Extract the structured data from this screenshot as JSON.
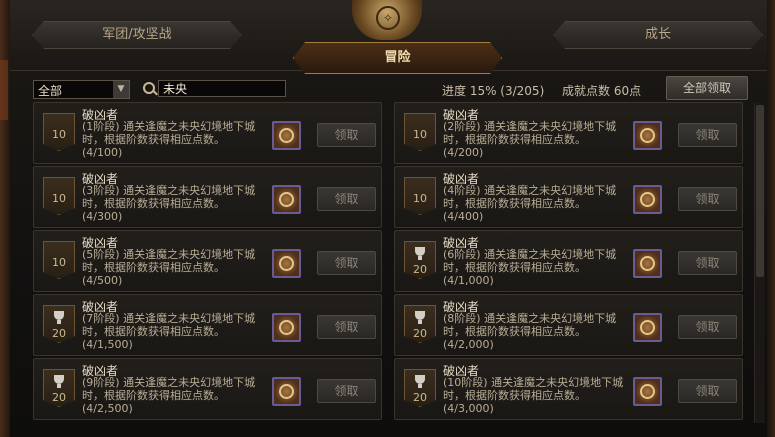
{
  "tabs": {
    "left": "军团/攻坚战",
    "active": "冒险",
    "right": "成长"
  },
  "filter": {
    "selected": "全部",
    "search_value": "未央"
  },
  "stats": {
    "progress": "进度 15% (3/205)",
    "points": "成就点数 60点",
    "claim_all": "全部领取"
  },
  "achievements": [
    {
      "title": "破凶者",
      "desc": "(1阶段) 通关逢魔之未央幻境地下城时，根据阶数获得相应点数。",
      "progress": "(4/100)",
      "points": "10",
      "trophy": false,
      "claim": "领取"
    },
    {
      "title": "破凶者",
      "desc": "(2阶段) 通关逢魔之未央幻境地下城时，根据阶数获得相应点数。",
      "progress": "(4/200)",
      "points": "10",
      "trophy": false,
      "claim": "领取"
    },
    {
      "title": "破凶者",
      "desc": "(3阶段) 通关逢魔之未央幻境地下城时，根据阶数获得相应点数。",
      "progress": "(4/300)",
      "points": "10",
      "trophy": false,
      "claim": "领取"
    },
    {
      "title": "破凶者",
      "desc": "(4阶段) 通关逢魔之未央幻境地下城时，根据阶数获得相应点数。",
      "progress": "(4/400)",
      "points": "10",
      "trophy": false,
      "claim": "领取"
    },
    {
      "title": "破凶者",
      "desc": "(5阶段) 通关逢魔之未央幻境地下城时，根据阶数获得相应点数。",
      "progress": "(4/500)",
      "points": "10",
      "trophy": false,
      "claim": "领取"
    },
    {
      "title": "破凶者",
      "desc": "(6阶段) 通关逢魔之未央幻境地下城时，根据阶数获得相应点数。",
      "progress": "(4/1,000)",
      "points": "20",
      "trophy": true,
      "claim": "领取"
    },
    {
      "title": "破凶者",
      "desc": "(7阶段) 通关逢魔之未央幻境地下城时，根据阶数获得相应点数。",
      "progress": "(4/1,500)",
      "points": "20",
      "trophy": true,
      "claim": "领取"
    },
    {
      "title": "破凶者",
      "desc": "(8阶段) 通关逢魔之未央幻境地下城时，根据阶数获得相应点数。",
      "progress": "(4/2,000)",
      "points": "20",
      "trophy": true,
      "claim": "领取"
    },
    {
      "title": "破凶者",
      "desc": "(9阶段) 通关逢魔之未央幻境地下城时，根据阶数获得相应点数。",
      "progress": "(4/2,500)",
      "points": "20",
      "trophy": true,
      "claim": "领取"
    },
    {
      "title": "破凶者",
      "desc": "(10阶段) 通关逢魔之未央幻境地下城时，根据阶数获得相应点数。",
      "progress": "(4/3,000)",
      "points": "20",
      "trophy": true,
      "claim": "领取"
    }
  ]
}
